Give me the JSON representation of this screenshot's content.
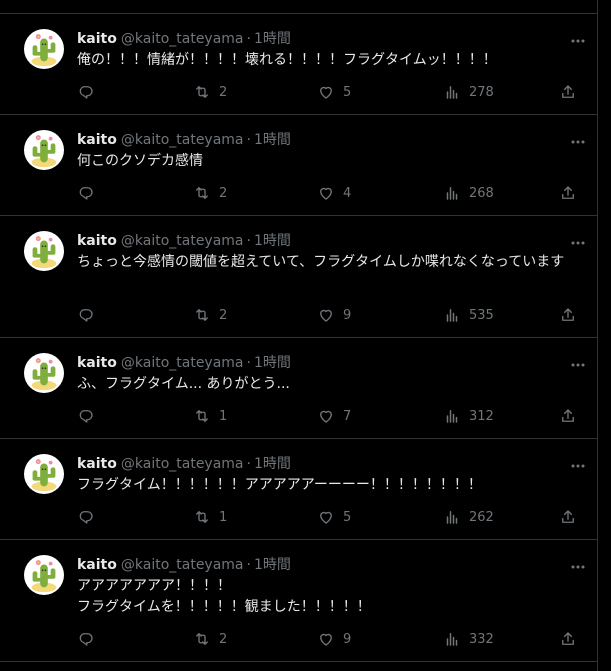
{
  "icons": {
    "avatar": "cactus-avatar-icon",
    "more": "more-horizontal-icon",
    "reply": "reply-icon",
    "retweet": "retweet-icon",
    "like": "heart-icon",
    "views": "views-chart-icon",
    "share": "share-icon"
  },
  "colors": {
    "background": "#000000",
    "text": "#e7e9ea",
    "muted": "#71767b",
    "divider": "#2f3336"
  },
  "tweets": [
    {
      "author": {
        "name": "kaito",
        "handle": "@kaito_tateyama"
      },
      "separator": "·",
      "time": "1時間",
      "text": "俺の！！！情緒が！！！！壊れる！！！！フラグタイムッ！！！！",
      "stats": {
        "replies": "",
        "retweets": "2",
        "likes": "5",
        "views": "278"
      }
    },
    {
      "author": {
        "name": "kaito",
        "handle": "@kaito_tateyama"
      },
      "separator": "·",
      "time": "1時間",
      "text": "何このクソデカ感情",
      "stats": {
        "replies": "",
        "retweets": "2",
        "likes": "4",
        "views": "268"
      }
    },
    {
      "author": {
        "name": "kaito",
        "handle": "@kaito_tateyama"
      },
      "separator": "·",
      "time": "1時間",
      "text": "ちょっと今感情の閾値を超えていて、フラグタイムしか喋れなくなっています",
      "stats": {
        "replies": "",
        "retweets": "2",
        "likes": "9",
        "views": "535"
      }
    },
    {
      "author": {
        "name": "kaito",
        "handle": "@kaito_tateyama"
      },
      "separator": "·",
      "time": "1時間",
      "text": "ふ、フラグタイム... ありがとう...",
      "stats": {
        "replies": "",
        "retweets": "1",
        "likes": "7",
        "views": "312"
      }
    },
    {
      "author": {
        "name": "kaito",
        "handle": "@kaito_tateyama"
      },
      "separator": "·",
      "time": "1時間",
      "text": "フラグタイム！！！！！！アアアアアーーーー！！！！！！！！",
      "stats": {
        "replies": "",
        "retweets": "1",
        "likes": "5",
        "views": "262"
      }
    },
    {
      "author": {
        "name": "kaito",
        "handle": "@kaito_tateyama"
      },
      "separator": "·",
      "time": "1時間",
      "text": "アアアアアアア！！！！\nフラグタイムを！！！！！観ました！！！！！",
      "stats": {
        "replies": "",
        "retweets": "2",
        "likes": "9",
        "views": "332"
      }
    }
  ]
}
